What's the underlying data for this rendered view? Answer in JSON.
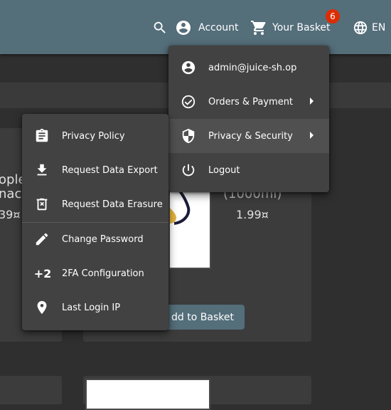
{
  "toolbar": {
    "account_label": "Account",
    "basket_label": "Your Basket",
    "basket_count": "6",
    "language": "EN"
  },
  "products": {
    "left_name_line1": "ople",
    "left_name_line2": "nac",
    "left_price": "39¤",
    "mid_name_line2": "(1000ml)",
    "mid_price": "1.99¤",
    "add_to_basket": "dd to Basket"
  },
  "account_menu": {
    "email": "admin@juice-sh.op",
    "orders": "Orders & Payment",
    "privacy": "Privacy & Security",
    "logout": "Logout"
  },
  "privacy_menu": {
    "items": [
      {
        "label": "Privacy Policy",
        "icon": "clipboard-icon"
      },
      {
        "label": "Request Data Export",
        "icon": "download-icon"
      },
      {
        "label": "Request Data Erasure",
        "icon": "delete-icon"
      },
      {
        "label": "Change Password",
        "icon": "pencil-icon"
      },
      {
        "label": "2FA Configuration",
        "icon": "plus-two-icon"
      },
      {
        "label": "Last Login IP",
        "icon": "location-pin-icon"
      }
    ],
    "twofa_glyph": "+2"
  },
  "colors": {
    "toolbar": "#546e7a",
    "background": "#2f2f2f",
    "menu": "#424242",
    "badge": "#dd2c00"
  }
}
